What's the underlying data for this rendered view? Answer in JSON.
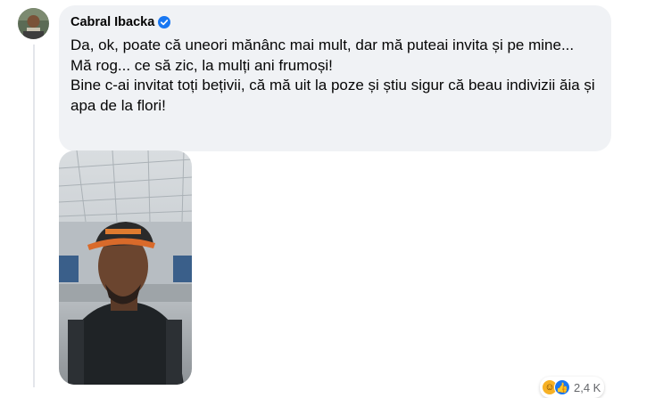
{
  "comment": {
    "author": "Cabral Ibacka",
    "verified": true,
    "text_lines": [
      "Da, ok, poate că uneori mănânc mai mult, dar mă puteai invita și pe mine...",
      "Mă rog... ce să zic, la mulți ani frumoși!",
      "Bine c-ai invitat toți bețivii, că mă uit la poze și știu sigur că beau indivizii ăia și apa de la flori!"
    ],
    "reactions": {
      "icons": [
        "haha-icon",
        "like-icon"
      ],
      "count": "2,4 K"
    }
  },
  "colors": {
    "bubble_bg": "#f0f2f5",
    "verified_blue": "#1877f2",
    "text": "#050505",
    "secondary_text": "#65676b"
  }
}
